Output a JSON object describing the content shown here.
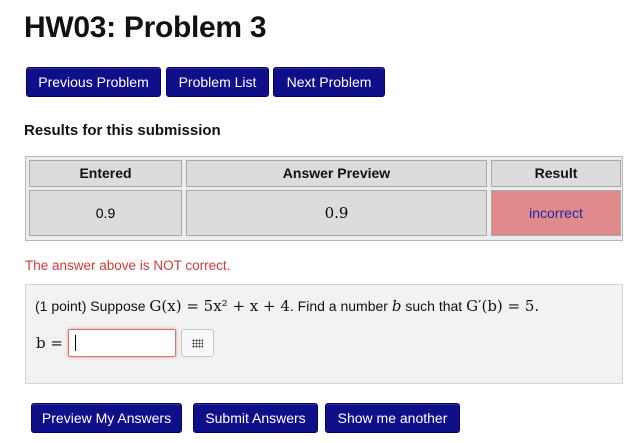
{
  "page": {
    "title": "HW03: Problem 3"
  },
  "nav": {
    "previous_label": "Previous Problem",
    "list_label": "Problem List",
    "next_label": "Next Problem"
  },
  "results": {
    "heading": "Results for this submission",
    "columns": [
      "Entered",
      "Answer Preview",
      "Result"
    ],
    "rows": [
      {
        "entered": "0.9",
        "preview": "0.9",
        "result": "incorrect"
      }
    ],
    "incorrect_color": "#e08b8b"
  },
  "feedback": {
    "message": "The answer above is NOT correct."
  },
  "problem": {
    "points": "(1 point)",
    "text_suppose": "Suppose",
    "equation": "G(x) = 5x² + x + 4",
    "text_find": ". Find a number",
    "variable": "b",
    "text_such_that": "such that",
    "condition": "G′(b) = 5",
    "period": ".",
    "answer_label": "b =",
    "answer_value": "",
    "palette_icon": "grid-icon"
  },
  "actions": {
    "preview_label": "Preview My Answers",
    "submit_label": "Submit Answers",
    "another_label": "Show me another"
  },
  "colors": {
    "button_bg": "#0f0f8a",
    "error_text": "#d23b3b"
  }
}
